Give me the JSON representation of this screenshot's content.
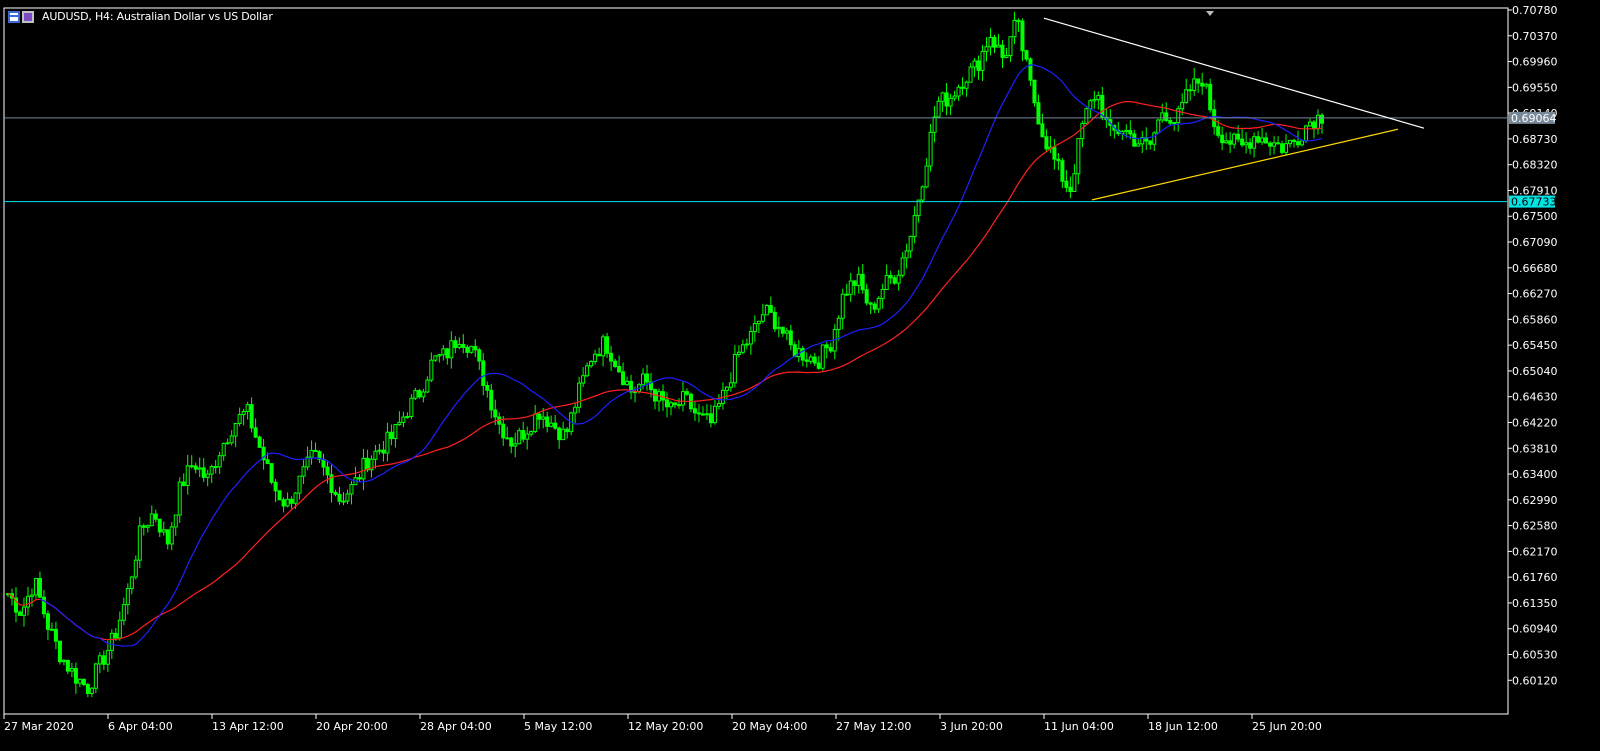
{
  "window": {
    "title": "AUDUSD, H4:  Australian Dollar vs US Dollar"
  },
  "colors": {
    "background": "#000000",
    "candle": "#00ff00",
    "ma_fast": "#1f1fff",
    "ma_slow": "#ff2020",
    "bid_line": "#778899",
    "support_line": "#00e5e5",
    "resistance_trend": "#ffffff",
    "support_trend": "#ffd700"
  },
  "chart_data": {
    "type": "candlestick",
    "symbol": "AUDUSD",
    "timeframe": "H4",
    "description": "Australian Dollar vs US Dollar",
    "y_ticks": [
      "0.70780",
      "0.70370",
      "0.69960",
      "0.69550",
      "0.69140",
      "0.68730",
      "0.68320",
      "0.67910",
      "0.67500",
      "0.67090",
      "0.66680",
      "0.66270",
      "0.65860",
      "0.65450",
      "0.65040",
      "0.64630",
      "0.64220",
      "0.63810",
      "0.63400",
      "0.62990",
      "0.62580",
      "0.62170",
      "0.61760",
      "0.61350",
      "0.60940",
      "0.60530",
      "0.60120"
    ],
    "x_ticks": [
      "27 Mar 2020",
      "6 Apr 04:00",
      "13 Apr 12:00",
      "20 Apr 20:00",
      "28 Apr 04:00",
      "5 May 12:00",
      "12 May 20:00",
      "20 May 04:00",
      "27 May 12:00",
      "3 Jun 20:00",
      "11 Jun 04:00",
      "18 Jun 12:00",
      "25 Jun 20:00"
    ],
    "ylim": [
      0.598,
      0.7082
    ],
    "price_tags": [
      {
        "value": 0.69064,
        "label": "0.69064",
        "kind": "bid"
      },
      {
        "value": 0.67733,
        "label": "0.67733",
        "kind": "horizontal"
      }
    ],
    "trend_lines": [
      {
        "name": "resistance",
        "from": [
          0.7065
        ],
        "to": [
          0.6898
        ]
      },
      {
        "name": "support",
        "from": [
          0.6776
        ],
        "to": [
          0.689
        ]
      }
    ],
    "price_path": [
      0.615,
      0.612,
      0.617,
      0.61,
      0.605,
      0.602,
      0.6,
      0.604,
      0.608,
      0.615,
      0.625,
      0.628,
      0.623,
      0.632,
      0.636,
      0.633,
      0.638,
      0.642,
      0.644,
      0.638,
      0.632,
      0.629,
      0.633,
      0.637,
      0.634,
      0.63,
      0.632,
      0.636,
      0.638,
      0.64,
      0.644,
      0.647,
      0.652,
      0.653,
      0.656,
      0.654,
      0.648,
      0.642,
      0.639,
      0.641,
      0.644,
      0.642,
      0.64,
      0.647,
      0.653,
      0.655,
      0.651,
      0.647,
      0.649,
      0.646,
      0.644,
      0.646,
      0.643,
      0.642,
      0.647,
      0.653,
      0.656,
      0.66,
      0.658,
      0.654,
      0.653,
      0.652,
      0.655,
      0.663,
      0.665,
      0.66,
      0.664,
      0.666,
      0.672,
      0.682,
      0.693,
      0.694,
      0.697,
      0.699,
      0.704,
      0.7,
      0.706,
      0.696,
      0.688,
      0.683,
      0.679,
      0.69,
      0.695,
      0.688,
      0.689,
      0.687,
      0.686,
      0.692,
      0.69,
      0.695,
      0.697,
      0.689,
      0.687,
      0.686,
      0.688,
      0.687,
      0.686,
      0.687,
      0.69,
      0.691
    ]
  }
}
